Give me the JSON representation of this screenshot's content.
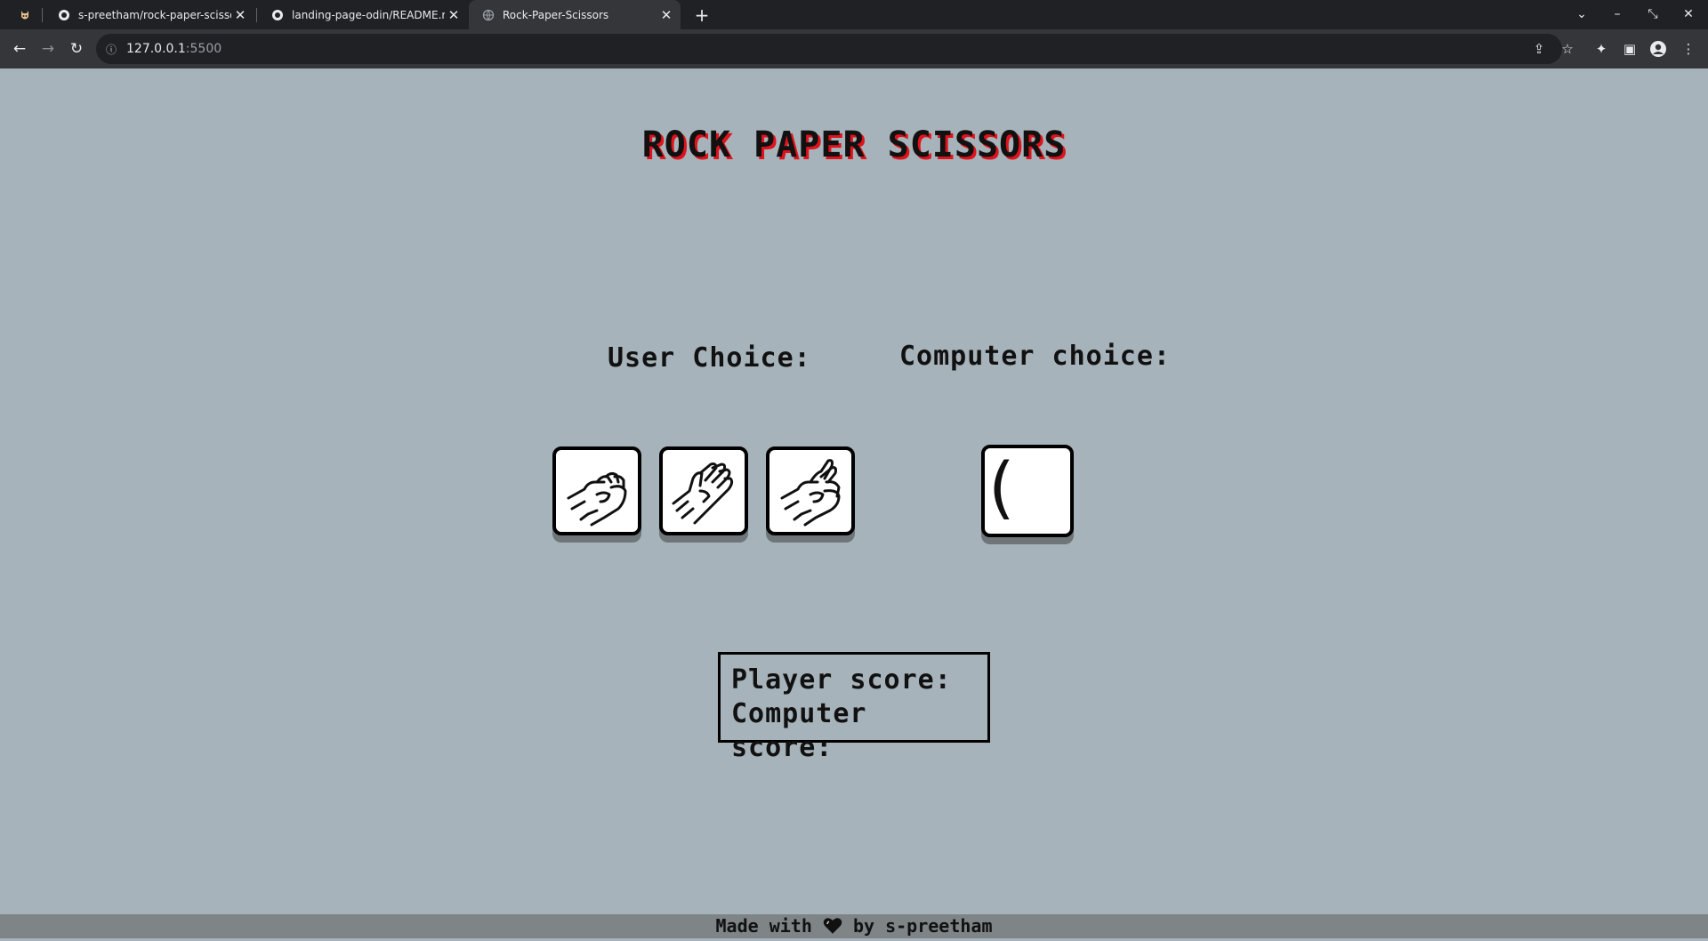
{
  "browser": {
    "tabs": [
      {
        "title": "s-preetham/rock-paper-scissors",
        "favicon": "github-icon",
        "active": false
      },
      {
        "title": "landing-page-odin/README.md",
        "favicon": "github-icon",
        "active": false
      },
      {
        "title": "Rock-Paper-Scissors",
        "favicon": "globe-icon",
        "active": true
      }
    ],
    "url_host": "127.0.0.1",
    "url_port": ":5500"
  },
  "page": {
    "title": "ROCK PAPER SCISSORS",
    "user_choice_label": "User Choice:",
    "computer_choice_label": "Computer choice:",
    "choices": [
      {
        "name": "rock",
        "icon": "rock-hand-icon"
      },
      {
        "name": "paper",
        "icon": "paper-hand-icon"
      },
      {
        "name": "scissors",
        "icon": "scissors-hand-icon"
      }
    ],
    "computer_choice_display": "(",
    "player_score_label": "Player score:",
    "computer_score_label": "Computer score:",
    "footer_prefix": "Made with",
    "footer_suffix": "by s-preetham"
  },
  "colors": {
    "page_background": "#a7b3ba",
    "title_shadow": "#e0121b",
    "footer_background": "#7f8487"
  }
}
